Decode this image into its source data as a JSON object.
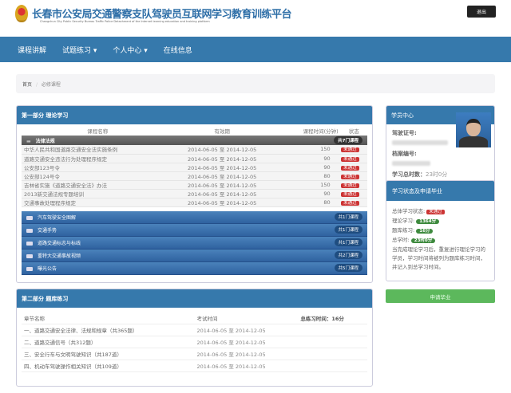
{
  "header": {
    "title": "长春市公安局交通警察支队驾驶员互联网学习教育训练平台",
    "subtitle": "Changchun City Public Security Bureau Traffic Police Detachment of the Internet learning education and training platform",
    "logout": "退出"
  },
  "nav": [
    {
      "label": "课程讲解"
    },
    {
      "label": "试题练习 ▾"
    },
    {
      "label": "个人中心 ▾"
    },
    {
      "label": "在线信息"
    }
  ],
  "breadcrumb": {
    "home": "首页",
    "sep": "/",
    "current": "必修课程"
  },
  "part1": {
    "title": "第一部分 理论学习",
    "headers": [
      "课程名称",
      "有效期",
      "课程时间(分钟)",
      "状态"
    ],
    "group": {
      "name": "法律法规",
      "count": "共7门课程"
    },
    "rows": [
      {
        "name": "中华人民共和国道路交通安全法实施条例",
        "period": "2014-06-05 至 2014-12-05",
        "minutes": "150",
        "status": "未通过"
      },
      {
        "name": "道路交通安全违法行为处理程序规定",
        "period": "2014-06-05 至 2014-12-05",
        "minutes": "90",
        "status": "未通过"
      },
      {
        "name": "公安部123号令",
        "period": "2014-06-05 至 2014-12-05",
        "minutes": "90",
        "status": "未通过"
      },
      {
        "name": "公安部124号令",
        "period": "2014-06-05 至 2014-12-05",
        "minutes": "80",
        "status": "未通过"
      },
      {
        "name": "吉林省实施《道路交通安全法》办法",
        "period": "2014-06-05 至 2014-12-05",
        "minutes": "150",
        "status": "未通过"
      },
      {
        "name": "2013新交通法规专题培训",
        "period": "2014-06-05 至 2014-12-05",
        "minutes": "90",
        "status": "未通过"
      },
      {
        "name": "交通事故处理程序规定",
        "period": "2014-06-05 至 2014-12-05",
        "minutes": "80",
        "status": "未通过"
      }
    ],
    "categories": [
      {
        "name": "汽车驾驶安全图解",
        "count": "共1门课程"
      },
      {
        "name": "交通手势",
        "count": "共1门课程"
      },
      {
        "name": "道路交通标志与标线",
        "count": "共1门课程"
      },
      {
        "name": "重特大交通事故视频",
        "count": "共2门课程"
      },
      {
        "name": "曝光公告",
        "count": "共5门课程"
      }
    ]
  },
  "part2": {
    "title": "第二部分 题库练习",
    "headers": [
      "章节名称",
      "考试时间"
    ],
    "total": "总练习时间：16分",
    "rows": [
      {
        "name": "一、道路交通安全法律、法规和规章（共365题）",
        "period": "2014-06-05 至 2014-12-05"
      },
      {
        "name": "二、道路交通信号（共312题）",
        "period": "2014-06-05 至 2014-12-05"
      },
      {
        "name": "三、安全行车与文明驾驶知识（共187道）",
        "period": "2014-06-05 至 2014-12-05"
      },
      {
        "name": "四、机动车驾驶操作相关知识（共109道）",
        "period": "2014-06-05 至 2014-12-05"
      }
    ]
  },
  "student": {
    "title": "学员中心",
    "license_label": "驾驶证号:",
    "file_label": "档案编号:",
    "total_label": "学习总时数：",
    "total_value": "23时0分"
  },
  "status": {
    "title": "学习状态及申请毕业",
    "overall_label": "总体学习状态:",
    "overall_value": "未通过",
    "theory_label": "理论学习:",
    "theory_value": "1364分",
    "bank_label": "题库练习:",
    "bank_value": "16分",
    "total_label": "总学时:",
    "total_value": "23时0分",
    "note": "当完成理论学习后，重复进行理论学习的学员，学习时间将被列为题库练习时间，并记入到总学习时间。"
  },
  "apply_button": "申请毕业",
  "colors": {
    "primary": "#3679ac",
    "danger": "#c33333",
    "success": "#3e8a3e",
    "apply": "#5cb85c"
  }
}
